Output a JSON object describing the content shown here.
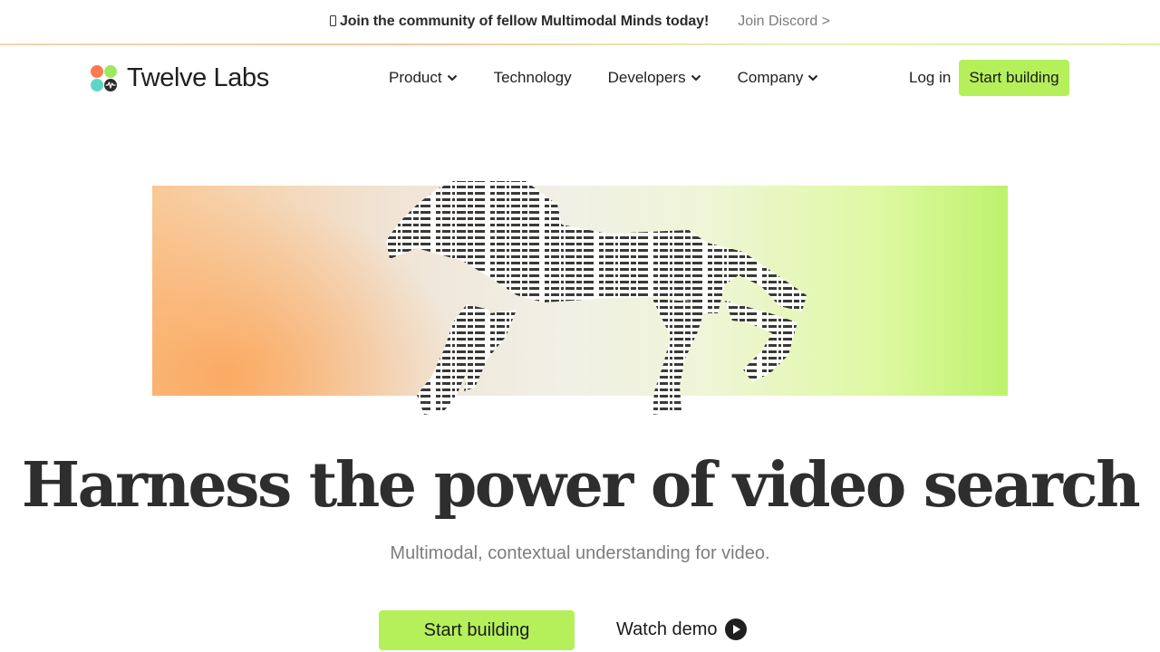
{
  "announcement": {
    "text": "Join the community of fellow Multimodal Minds today!",
    "link": "Join Discord >"
  },
  "brand": {
    "name": "Twelve Labs"
  },
  "nav": {
    "items": [
      {
        "label": "Product",
        "dropdown": true
      },
      {
        "label": "Technology",
        "dropdown": false
      },
      {
        "label": "Developers",
        "dropdown": true
      },
      {
        "label": "Company",
        "dropdown": true
      }
    ],
    "login": "Log in",
    "cta": "Start building"
  },
  "hero": {
    "title": "Harness the power of video search",
    "subtitle": "Multimodal, contextual understanding for video.",
    "cta_primary": "Start building",
    "cta_secondary": "Watch demo"
  },
  "colors": {
    "accent": "#b5f05b",
    "text": "#2e2e2e",
    "muted": "#7d7d7d"
  }
}
